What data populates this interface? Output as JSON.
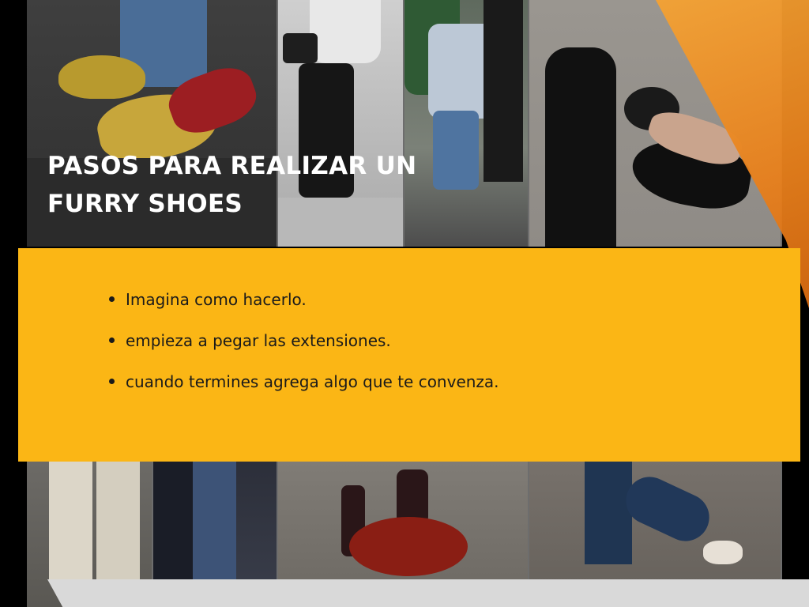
{
  "slide": {
    "title": "PASOS PARA REALIZAR UN FURRY SHOES",
    "bullets": [
      "Imagina como hacerlo.",
      "empieza a pegar las extensiones.",
      "cuando termines agrega algo que te convenza."
    ]
  },
  "colors": {
    "panel": "#fbb615",
    "accent": "#e8801c",
    "background": "#000000"
  }
}
